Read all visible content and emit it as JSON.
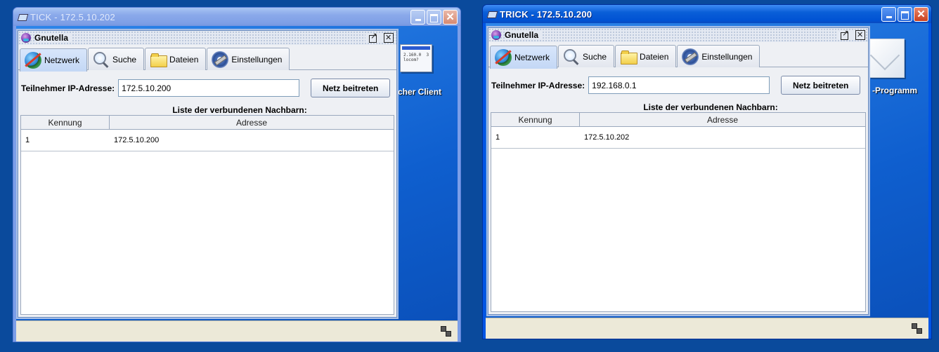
{
  "desktop": {
    "bg_color": "#0a4a9c",
    "icon_left_label": "cher Client",
    "icon_left_screen_text": "2.160.0  3\nlocom?",
    "icon_right_label": "-Programm"
  },
  "window_tick": {
    "title": "TICK - 172.5.10.202",
    "gnutella": {
      "title": "Gnutella",
      "tabs": [
        {
          "label": "Netzwerk",
          "icon": "globe-icon",
          "active": true
        },
        {
          "label": "Suche",
          "icon": "magnifier-icon"
        },
        {
          "label": "Dateien",
          "icon": "folder-icon"
        },
        {
          "label": "Einstellungen",
          "icon": "settings-icon"
        }
      ],
      "ip_label": "Teilnehmer IP-Adresse:",
      "ip_value": "172.5.10.200",
      "join_button": "Netz beitreten",
      "list_caption": "Liste der verbundenen Nachbarn:",
      "columns": [
        "Kennung",
        "Adresse"
      ],
      "rows": [
        {
          "id": "1",
          "address": "172.5.10.200"
        }
      ]
    }
  },
  "window_trick": {
    "title": "TRICK - 172.5.10.200",
    "gnutella": {
      "title": "Gnutella",
      "tabs": [
        {
          "label": "Netzwerk",
          "icon": "globe-icon",
          "active": true
        },
        {
          "label": "Suche",
          "icon": "magnifier-icon"
        },
        {
          "label": "Dateien",
          "icon": "folder-icon"
        },
        {
          "label": "Einstellungen",
          "icon": "settings-icon"
        }
      ],
      "ip_label": "Teilnehmer IP-Adresse:",
      "ip_value": "192.168.0.1",
      "join_button": "Netz beitreten",
      "list_caption": "Liste der verbundenen Nachbarn:",
      "columns": [
        "Kennung",
        "Adresse"
      ],
      "rows": [
        {
          "id": "1",
          "address": "172.5.10.202"
        }
      ]
    }
  }
}
